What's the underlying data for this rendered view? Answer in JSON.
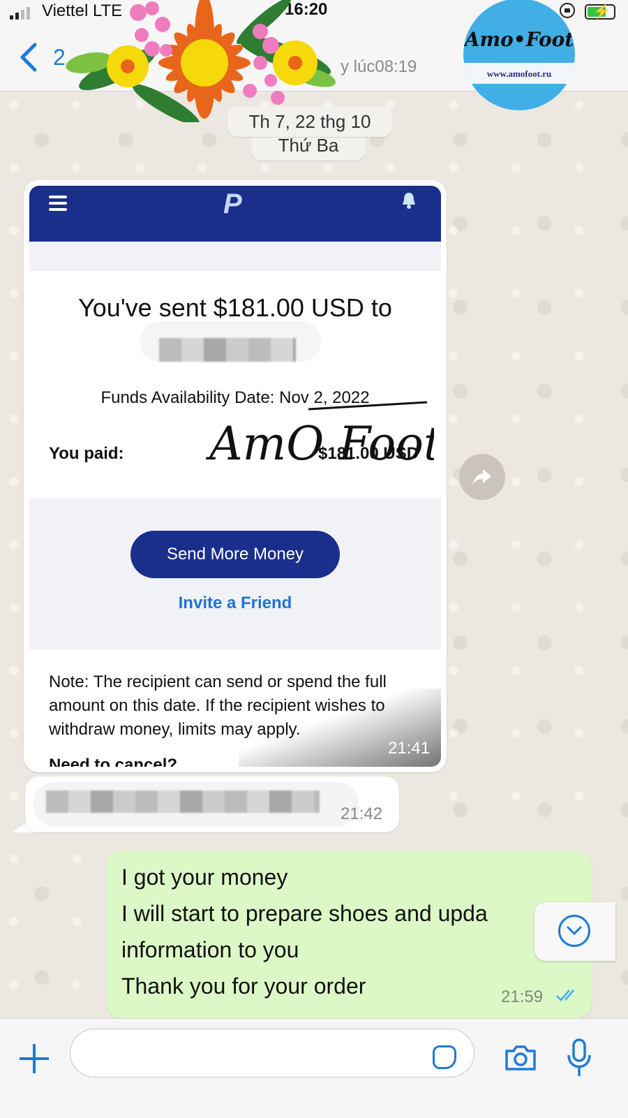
{
  "status_bar": {
    "carrier": "Viettel",
    "network": "LTE",
    "time": "16:20"
  },
  "header": {
    "back_count": "2",
    "last_seen": "y lúc08:19",
    "logo_text": "Amo•Foot",
    "logo_url": "www.amofoot.ru"
  },
  "chat": {
    "date_chip": "Th 7, 22 thg 10",
    "day_chip": "Thứ Ba",
    "image_message": {
      "time": "21:41",
      "paypal": {
        "logo": "P",
        "title": "You've sent $181.00 USD to",
        "funds_date": "Funds Availability Date: Nov 2, 2022",
        "paid_label": "You paid:",
        "paid_amount": "$181.00 USD",
        "send_more_button": "Send More Money",
        "invite_link": "Invite a Friend",
        "note": "Note: The recipient can send or spend the full amount on this date. If the recipient wishes to withdraw money, limits may apply.",
        "cancel_heading": "Need to cancel?"
      },
      "watermark": "AmO Foot"
    },
    "incoming_message": {
      "time": "21:42"
    },
    "outgoing_message": {
      "lines": [
        "I got your money",
        "I will start to prepare shoes and upda",
        "information to you",
        "Thank you for your order"
      ],
      "time": "21:59"
    }
  },
  "composer": {
    "placeholder": ""
  },
  "colors": {
    "accent": "#1e7bd6",
    "paypal_blue": "#1a2f8c",
    "outgoing_bubble": "#dcf8c6",
    "wallpaper": "#ece8e1"
  },
  "icons": [
    "back-chevron-icon",
    "forward-icon",
    "scroll-down-icon",
    "plus-icon",
    "sticker-icon",
    "camera-icon",
    "microphone-icon",
    "read-ticks-icon"
  ]
}
